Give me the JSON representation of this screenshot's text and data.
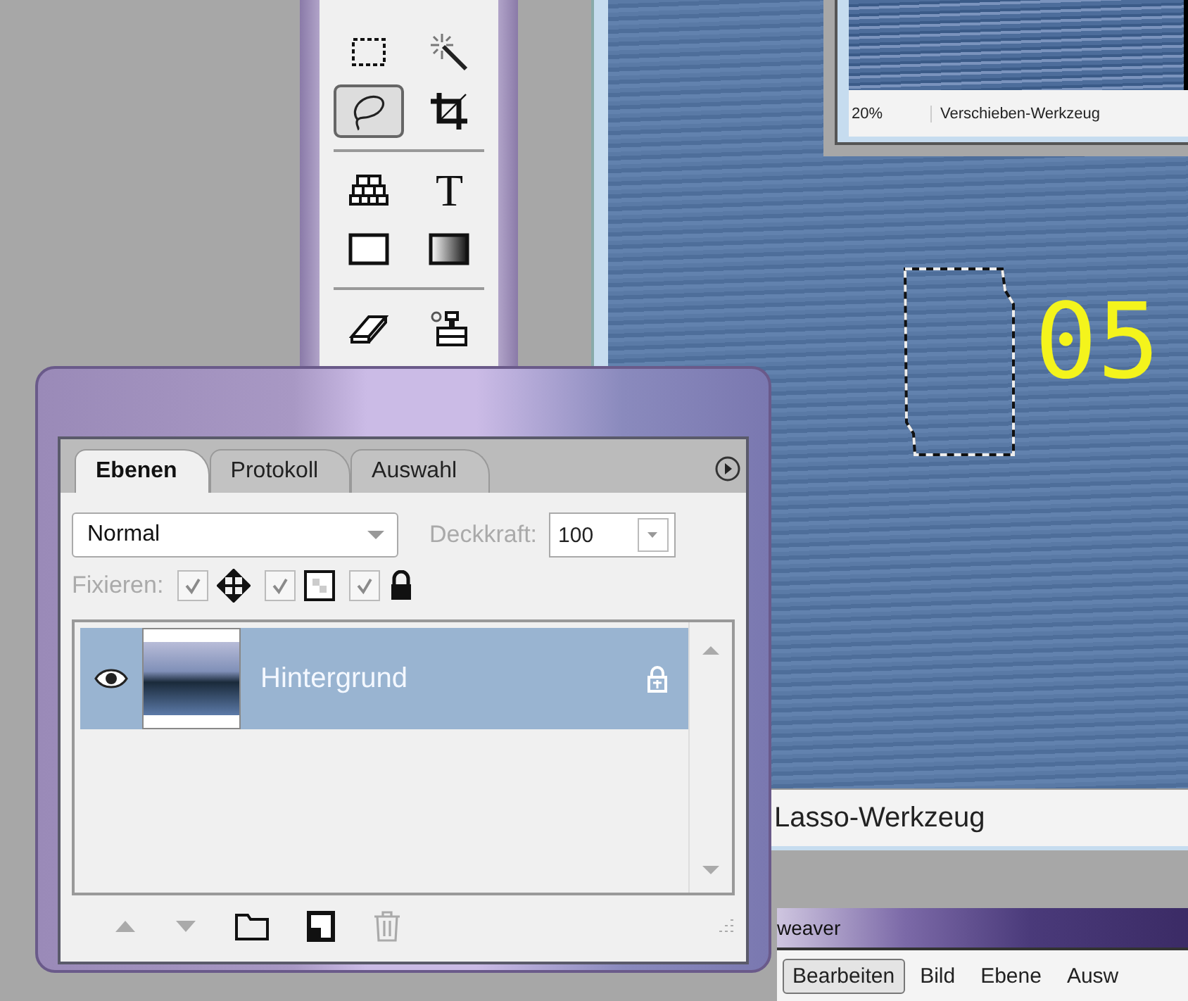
{
  "toolbox": {
    "tools": [
      {
        "kind": "marquee",
        "selected": false
      },
      {
        "kind": "wand",
        "selected": false
      },
      {
        "kind": "lasso",
        "selected": true
      },
      {
        "kind": "crop",
        "selected": false
      },
      {
        "kind": "bricks",
        "selected": false
      },
      {
        "kind": "text",
        "glyph": "T",
        "selected": false
      },
      {
        "kind": "shape",
        "selected": false
      },
      {
        "kind": "gradient",
        "selected": false
      },
      {
        "kind": "eraser",
        "selected": false
      },
      {
        "kind": "stamp",
        "selected": false
      }
    ]
  },
  "navigator_window": {
    "zoom": "20%",
    "status": "Verschieben-Werkzeug"
  },
  "canvas_window": {
    "canvas_text": "05",
    "status": "Lasso-Werkzeug"
  },
  "layers_panel": {
    "tabs": [
      {
        "label": "Ebenen",
        "selected": true
      },
      {
        "label": "Protokoll",
        "selected": false
      },
      {
        "label": "Auswahl",
        "selected": false
      }
    ],
    "blend_mode": "Normal",
    "opacity_label": "Deckkraft:",
    "opacity_value": "100",
    "lock_label": "Fixieren:",
    "locks": [
      {
        "kind": "position",
        "checked": true
      },
      {
        "kind": "transparency",
        "checked": true
      },
      {
        "kind": "all",
        "checked": true
      }
    ],
    "layers": [
      {
        "name": "Hintergrund",
        "selected": true,
        "visible": true,
        "locked": true
      }
    ],
    "footer": [
      {
        "kind": "up",
        "disabled": true
      },
      {
        "kind": "down",
        "disabled": true
      },
      {
        "kind": "folder",
        "disabled": false
      },
      {
        "kind": "new",
        "disabled": false
      },
      {
        "kind": "trash",
        "disabled": true
      }
    ]
  },
  "app_window": {
    "title": "weaver",
    "menu": [
      {
        "label": "Bearbeiten",
        "selected": true
      },
      {
        "label": "Bild",
        "selected": false
      },
      {
        "label": "Ebene",
        "selected": false
      },
      {
        "label": "Ausw",
        "selected": false
      }
    ]
  }
}
